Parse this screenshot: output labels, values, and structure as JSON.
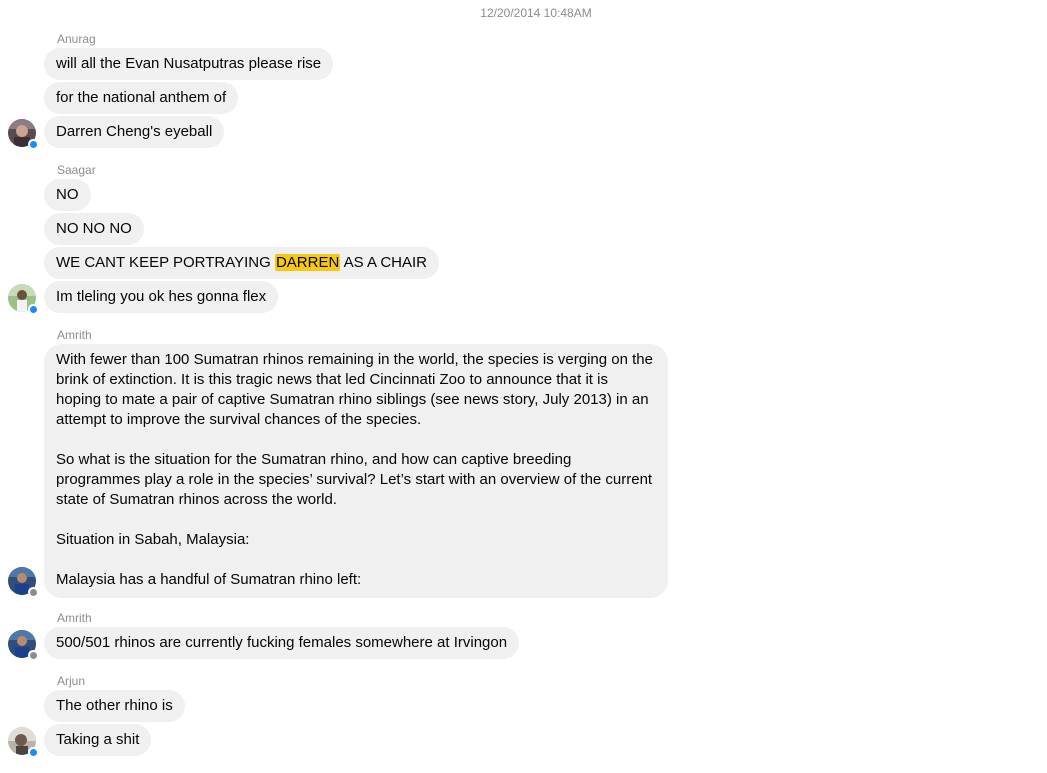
{
  "timestamp": "12/20/2014 10:48AM",
  "groups": [
    {
      "sender": "Anurag",
      "messages": [
        "will all the Evan Nusatputras please rise",
        "for the national anthem of",
        "Darren Cheng's eyeball"
      ],
      "avatar_icon": "profile-photo",
      "badge_icon": "messenger-badge-icon",
      "badge_color": "#1a8cff"
    },
    {
      "sender": "Saagar",
      "messages": [
        "NO",
        "NO NO NO",
        {
          "before": "WE CANT KEEP PORTRAYING ",
          "highlight": "DARREN",
          "after": " AS A CHAIR"
        },
        "Im tleling you ok hes gonna flex"
      ],
      "avatar_icon": "profile-photo",
      "badge_icon": "messenger-badge-icon",
      "badge_color": "#1a8cff"
    },
    {
      "sender": "Amrith",
      "paragraphs": [
        "With fewer than 100 Sumatran rhinos remaining in the world, the species is verging on the brink of extinction. It is this tragic news that led Cincinnati Zoo to announce that it is hoping to mate a pair of captive Sumatran rhino siblings (see news story, July 2013) in an attempt to improve the survival chances of the species.",
        "So what is the situation for the Sumatran rhino, and how can captive breeding programmes play a role in the species’ survival? Let’s start with an overview of the current state of Sumatran rhinos across the world.",
        "Situation in Sabah, Malaysia:",
        "Malaysia has a handful of Sumatran rhino left:"
      ],
      "avatar_icon": "profile-photo",
      "badge_icon": "facebook-badge-icon",
      "badge_color": "#8a8d91"
    },
    {
      "sender": "Amrith",
      "messages": [
        "500/501 rhinos are currently fucking females somewhere at Irvingon"
      ],
      "avatar_icon": "profile-photo",
      "badge_icon": "facebook-badge-icon",
      "badge_color": "#8a8d91"
    },
    {
      "sender": "Arjun",
      "messages": [
        "The other rhino is",
        "Taking a shit"
      ],
      "avatar_icon": "profile-photo",
      "badge_icon": "messenger-badge-icon",
      "badge_color": "#1a8cff"
    }
  ]
}
